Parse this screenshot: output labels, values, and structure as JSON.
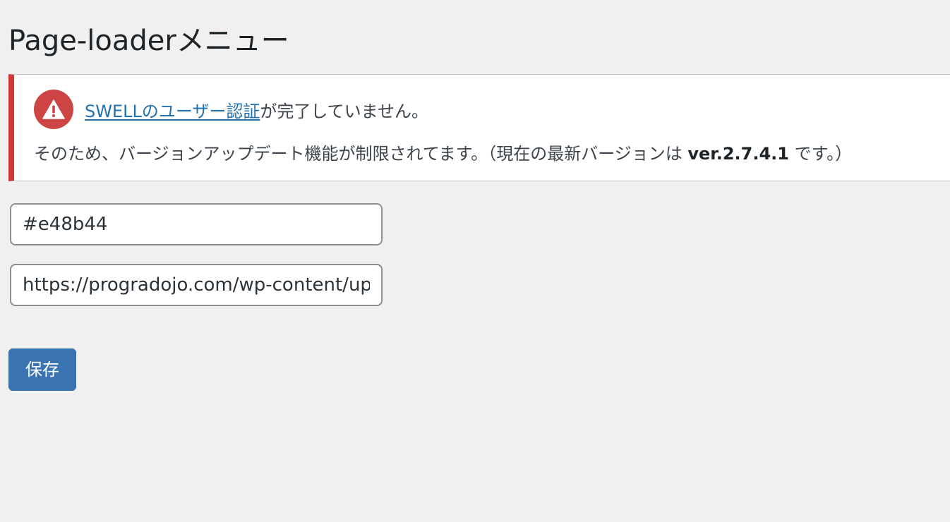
{
  "page": {
    "title": "Page-loaderメニュー"
  },
  "notice": {
    "type": "error",
    "icon": "warning-triangle-icon",
    "icon_color": "#cc4444",
    "border_color": "#d63638",
    "link_text": "SWELLのユーザー認証",
    "line1_suffix": "が完了していません。",
    "line2_prefix": "そのため、バージョンアップデート機能が制限されてます。（現在の最新バージョンは ",
    "version": "ver.2.7.4.1",
    "line2_suffix": " です。）"
  },
  "form": {
    "color_value": "#e48b44",
    "url_value": "https://progradojo.com/wp-content/up",
    "save_label": "保存",
    "save_color": "#3b74b3"
  }
}
